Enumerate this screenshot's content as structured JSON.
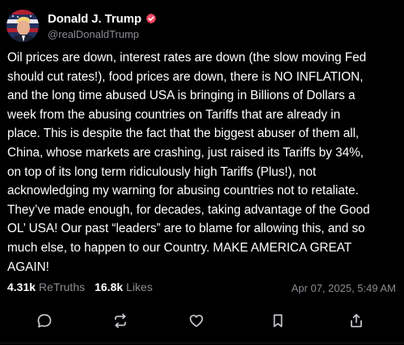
{
  "post": {
    "author": {
      "display_name": "Donald J. Trump",
      "handle": "@realDonaldTrump",
      "verified_color": "#ff4b66"
    },
    "text": "Oil prices are down, interest rates are down (the slow moving Fed\nshould cut rates!), food prices are down, there is NO INFLATION,\nand the long time abused USA is bringing in Billions of Dollars a\nweek from the abusing countries on Tariffs that are already in\nplace. This is despite the fact that the biggest abuser of them all,\nChina, whose markets are crashing, just raised its Tariffs by 34%,\non top of its long term ridiculously high Tariffs (Plus!), not\nacknowledging my warning for abusing countries not to retaliate.\nThey’ve made enough, for decades, taking advantage of the Good\nOL’ USA! Our past “leaders” are to blame for allowing this, and so\nmuch else, to happen to our Country. MAKE AMERICA GREAT\nAGAIN!",
    "stats": {
      "retruths_count": "4.31k",
      "retruths_label": "ReTruths",
      "likes_count": "16.8k",
      "likes_label": "Likes"
    },
    "timestamp": "Apr 07, 2025, 5:49 AM"
  },
  "actions": [
    {
      "name": "reply",
      "icon": "reply-icon"
    },
    {
      "name": "retruth",
      "icon": "retruth-icon"
    },
    {
      "name": "like",
      "icon": "heart-icon"
    },
    {
      "name": "bookmark",
      "icon": "bookmark-icon"
    },
    {
      "name": "share",
      "icon": "share-icon"
    }
  ],
  "colors": {
    "background": "#000000",
    "text": "#ffffff",
    "muted": "#8b8b93",
    "icon": "#c9c9d1"
  }
}
